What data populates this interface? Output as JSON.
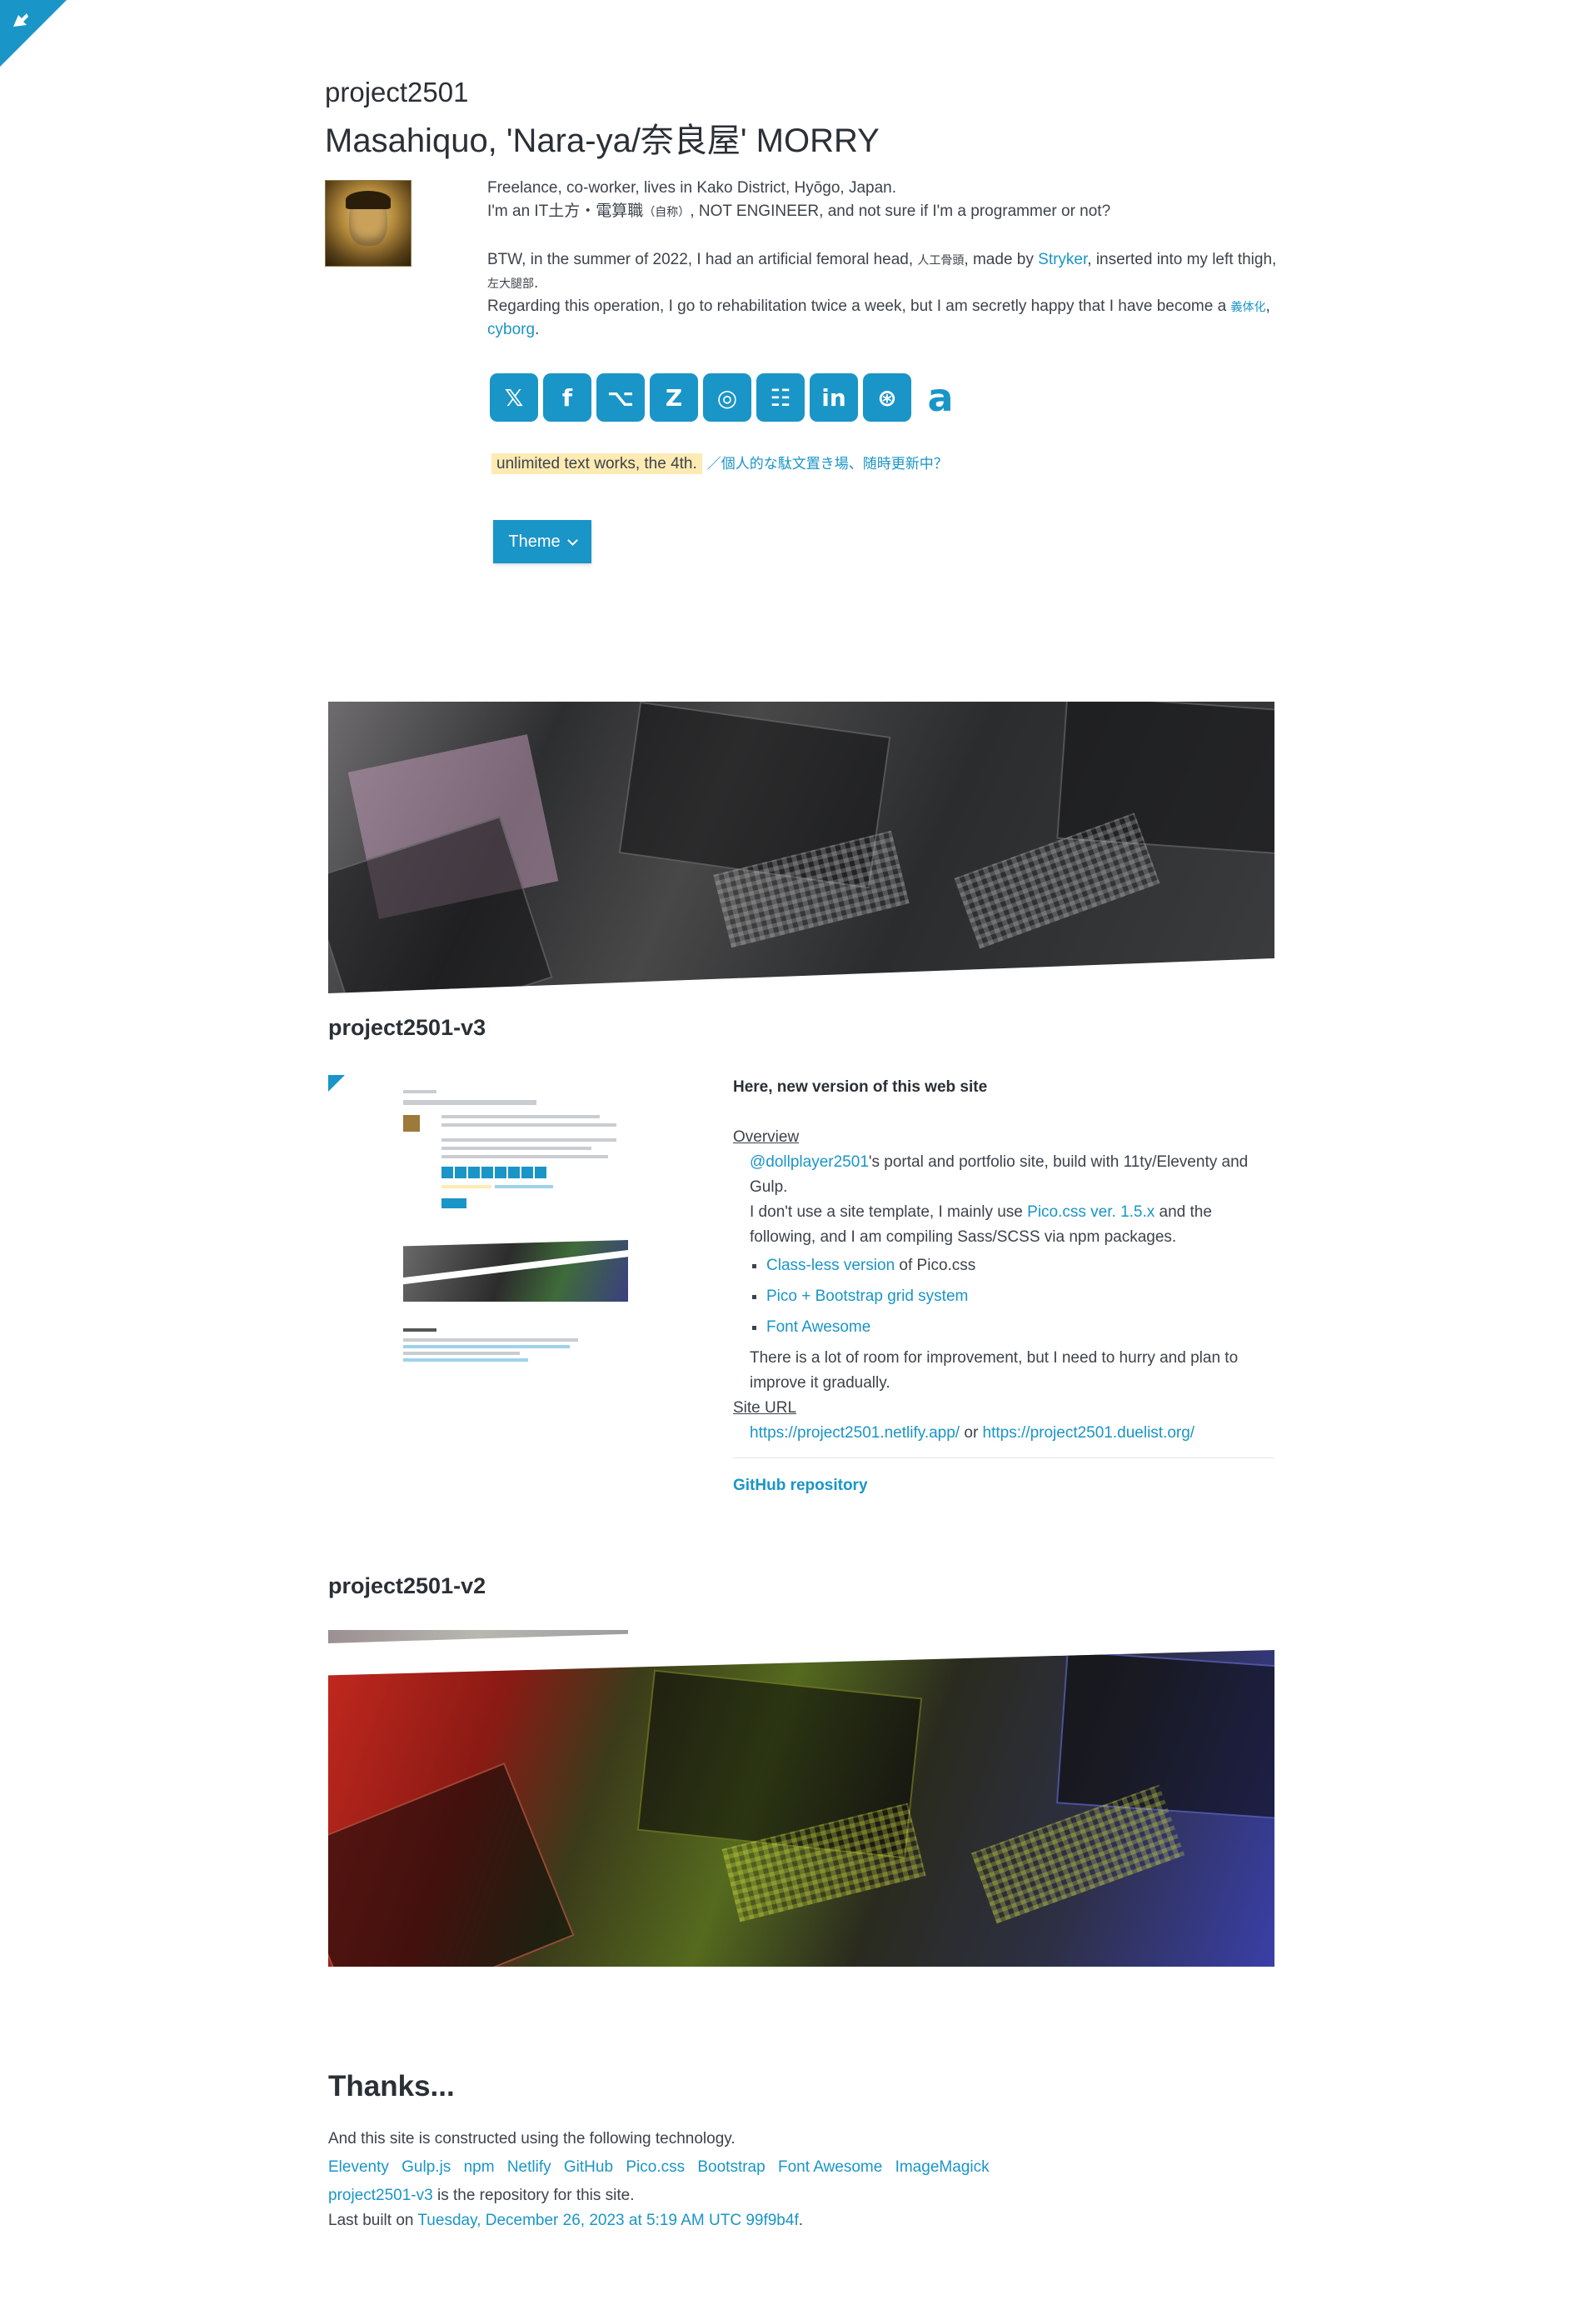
{
  "header": {
    "site_name": "project2501",
    "author_name": "Masahiquo, 'Nara-ya/奈良屋' MORRY"
  },
  "bio": {
    "line1": "Freelance, co-worker, lives in Kako District, Hyōgo, Japan.",
    "line2_a": "I'm an IT土方・電算職",
    "line2_small": "（自称）",
    "line2_b": ", NOT ENGINEER, and not sure if I'm a programmer or not?",
    "line3_a": "BTW, in the summer of 2022, I had an artificial femoral head,",
    "line3_small1": "人工骨頭",
    "line3_b": ", made by",
    "line3_link": "Stryker",
    "line3_c": ", inserted into my left thigh,",
    "line3_small2": "左大腿部",
    "line3_d": ".",
    "line4_a": "Regarding this operation, I go to rehabilitation twice a week, but I am secretly happy that I have become a",
    "line4_small": "義体化",
    "line4_link": "cyborg",
    "line4_b": "."
  },
  "socials": [
    {
      "icon": "x-twitter-icon",
      "glyph": "𝕏"
    },
    {
      "icon": "facebook-icon",
      "glyph": "f"
    },
    {
      "icon": "github-icon",
      "glyph": "⌥"
    },
    {
      "icon": "zenn-icon",
      "glyph": "Z"
    },
    {
      "icon": "instagram-icon",
      "glyph": "◎"
    },
    {
      "icon": "slideshare-icon",
      "glyph": "☷"
    },
    {
      "icon": "linkedin-icon",
      "glyph": "in"
    },
    {
      "icon": "steam-icon",
      "glyph": "⊛"
    },
    {
      "icon": "amazon-icon",
      "glyph": "a"
    }
  ],
  "tagline": {
    "highlight": "unlimited text works, the 4th.",
    "japanese": "／個人的な駄文置き場、随時更新中？"
  },
  "theme_button": "Theme",
  "sections": {
    "v3_title": "project2501-v3",
    "v2_title": "project2501-v2"
  },
  "project_v3": {
    "heading": "Here, new version of this web site",
    "overview_label": "Overview",
    "handle": "@dollplayer2501",
    "overview_a": "'s portal and portfolio site, build with 11ty/Eleventy and Gulp.",
    "overview_b": "I don't use a site template, I mainly use",
    "pico_link": "Pico.css ver. 1.5.x",
    "overview_c": "and the following, and I am compiling Sass/SCSS via npm packages.",
    "list": [
      {
        "link": "Class-less version",
        "rest": " of Pico.css"
      },
      {
        "link": "Pico + Bootstrap grid system",
        "rest": ""
      },
      {
        "link": "Font Awesome",
        "rest": ""
      }
    ],
    "improve": "There is a lot of room for improvement, but I need to hurry and plan to improve it gradually.",
    "site_url_label": "Site URL",
    "url1": "https://project2501.netlify.app/",
    "url_or": " or ",
    "url2": "https://project2501.duelist.org/",
    "github_link": "GitHub repository"
  },
  "thanks": {
    "title": "Thanks...",
    "intro": "And this site is constructed using the following technology.",
    "tech": [
      "Eleventy",
      "Gulp.js",
      "npm",
      "Netlify",
      "GitHub",
      "Pico.css",
      "Bootstrap",
      "Font Awesome",
      "ImageMagick"
    ],
    "repo_link": "project2501-v3",
    "repo_rest": " is the repository for this site.",
    "built_label": "Last built on ",
    "built_date": "Tuesday, December 26, 2023 at 5:19 AM UTC",
    "built_hash": "99f9b4f",
    "built_end": "."
  },
  "colors": {
    "accent": "#1a95c7",
    "highlight": "#fdebb3",
    "text": "#3d434b"
  }
}
